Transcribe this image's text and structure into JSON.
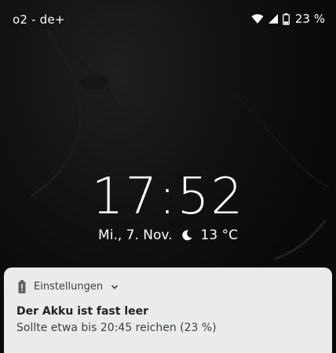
{
  "status_bar": {
    "carrier": "o2 - de+",
    "battery_percent": "23 %",
    "icons": [
      "wifi-icon",
      "cellular-signal-icon",
      "battery-icon"
    ]
  },
  "lockscreen": {
    "time": "17:52",
    "date": "Mi., 7. Nov.",
    "weather_icon": "moon-icon",
    "temperature": "13 °C"
  },
  "notification": {
    "app_name": "Einstellungen",
    "app_icon": "battery-alert-icon",
    "expand_icon": "chevron-down-icon",
    "title": "Der Akku ist fast leer",
    "text": "Sollte etwa bis 20:45 reichen (23 %)"
  },
  "colors": {
    "notification_background": "#ebebeb",
    "text_on_dark": "#ffffff",
    "wallpaper_dark": "#0b0b0b"
  }
}
